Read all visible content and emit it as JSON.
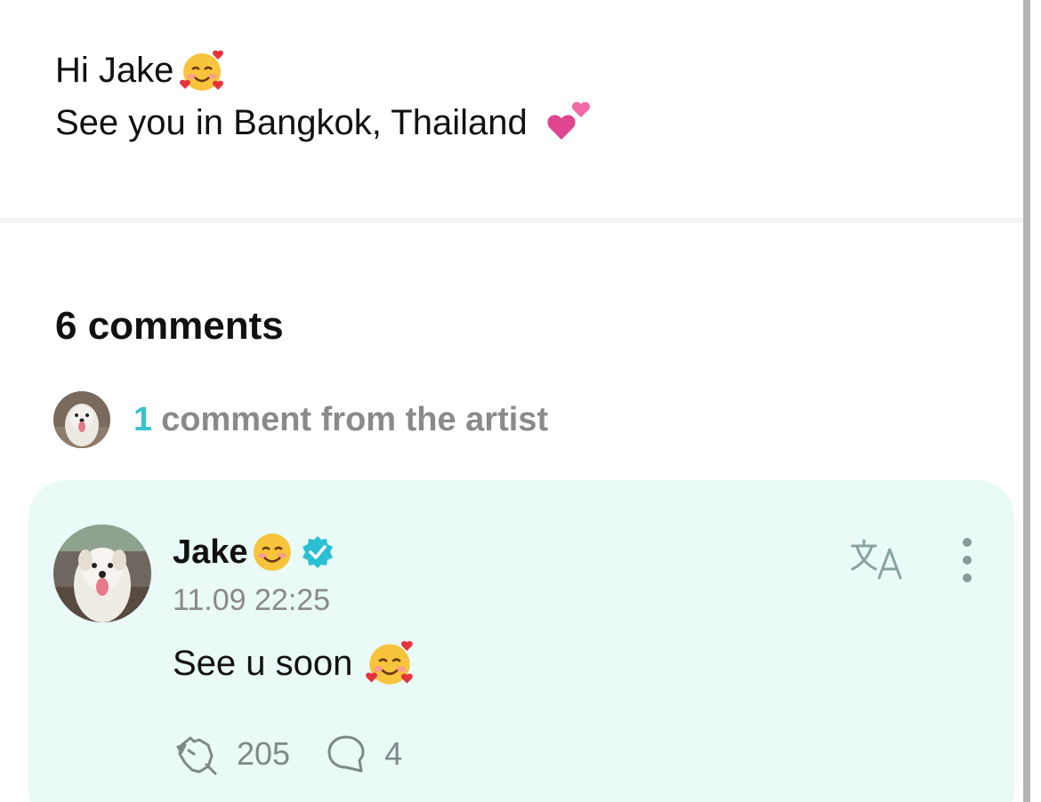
{
  "post": {
    "line1": "Hi Jake",
    "line1_emoji": "smiling-face-with-hearts-icon",
    "line2": "See you in Bangkok, Thailand",
    "line2_emoji": "two-hearts-icon"
  },
  "comments_header": {
    "title": "6 comments"
  },
  "artist_summary": {
    "count": "1",
    "label": "comment from the artist"
  },
  "comment": {
    "author": "Jake",
    "author_emoji": "smiling-face-icon",
    "verified": true,
    "timestamp": "11.09 22:25",
    "text": "See u soon",
    "text_emoji": "smiling-face-with-hearts-icon",
    "likes": "205",
    "replies": "4"
  },
  "colors": {
    "accent": "#39c3cf",
    "card_bg": "#e9faf7",
    "verified_badge": "#2bbfd4",
    "muted_text": "#8a8a8a"
  }
}
